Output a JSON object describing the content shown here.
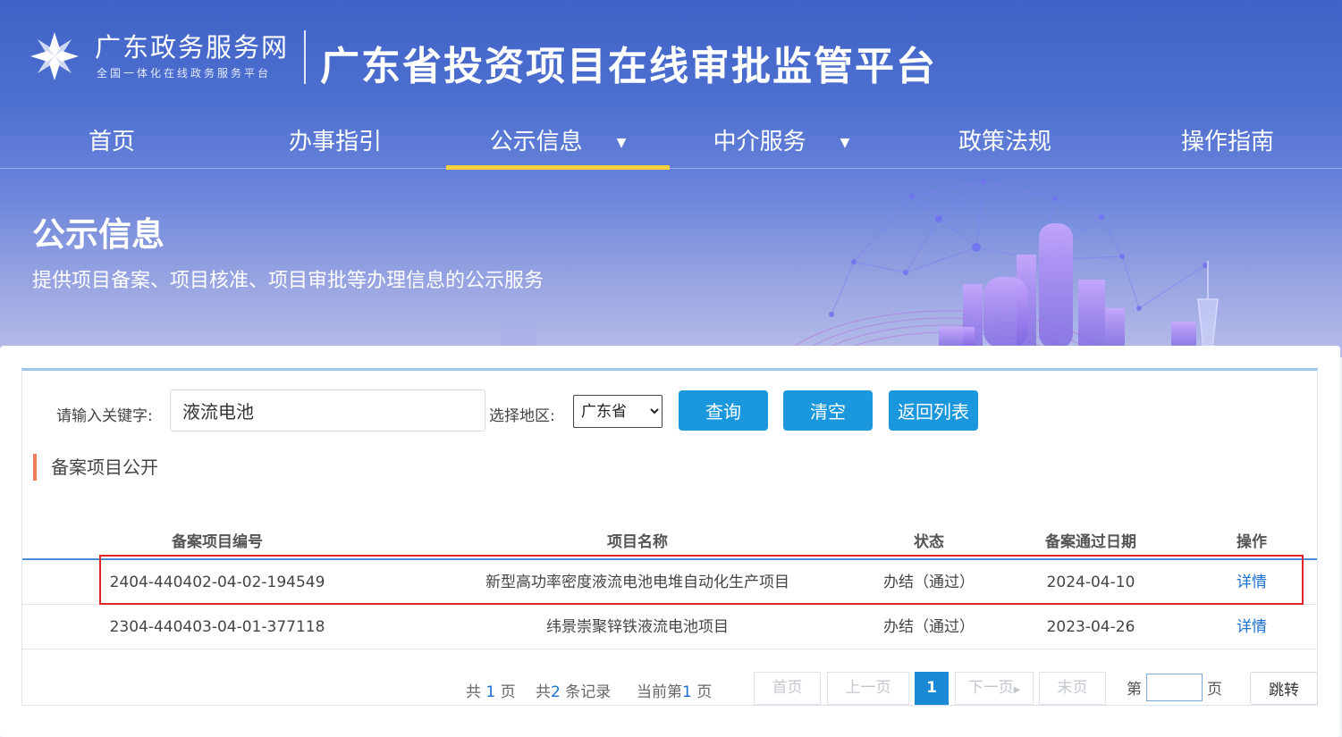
{
  "header": {
    "brand_name": "广东政务服务网",
    "brand_sub": "全国一体化在线政务服务平台",
    "platform_title": "广东省投资项目在线审批监管平台"
  },
  "nav": {
    "items": [
      {
        "label": "首页",
        "has_dropdown": false,
        "active": false
      },
      {
        "label": "办事指引",
        "has_dropdown": false,
        "active": false
      },
      {
        "label": "公示信息",
        "has_dropdown": true,
        "active": true
      },
      {
        "label": "中介服务",
        "has_dropdown": true,
        "active": false
      },
      {
        "label": "政策法规",
        "has_dropdown": false,
        "active": false
      },
      {
        "label": "操作指南",
        "has_dropdown": false,
        "active": false
      }
    ],
    "dropdown_glyph": "▼",
    "active_color": "#ffd23c"
  },
  "banner": {
    "title": "公示信息",
    "subtitle": "提供项目备案、项目核准、项目审批等办理信息的公示服务"
  },
  "search": {
    "keyword_label": "请输入关键字:",
    "keyword_value": "液流电池",
    "region_label": "选择地区:",
    "region_selected": "广东省",
    "buttons": {
      "query": "查询",
      "clear": "清空",
      "back": "返回列表"
    },
    "button_color": "#1b97dd"
  },
  "list": {
    "title": "备案项目公开",
    "columns": [
      "备案项目编号",
      "项目名称",
      "状态",
      "备案通过日期",
      "操作"
    ],
    "rows": [
      {
        "code": "2404-440402-04-02-194549",
        "name": "新型高功率密度液流电池电堆自动化生产项目",
        "status": "办结（通过）",
        "date": "2024-04-10",
        "action": "详情"
      },
      {
        "code": "2304-440403-04-01-377118",
        "name": "纬景崇聚锌铁液流电池项目",
        "status": "办结（通过）",
        "date": "2023-04-26",
        "action": "详情"
      }
    ],
    "highlight_color": "#e0262b"
  },
  "pagination": {
    "total_pages_prefix": "共",
    "total_pages": "1",
    "total_pages_suffix": "页",
    "total_records_prefix": "共",
    "total_records": "2",
    "total_records_suffix": "条记录",
    "current_prefix": "当前第",
    "current_page": "1",
    "current_suffix": "页",
    "first": "首页",
    "prev": "上一页",
    "page_number": "1",
    "next": "下一页",
    "last": "末页",
    "jump_prefix": "第",
    "jump_suffix": "页",
    "go": "跳转"
  }
}
